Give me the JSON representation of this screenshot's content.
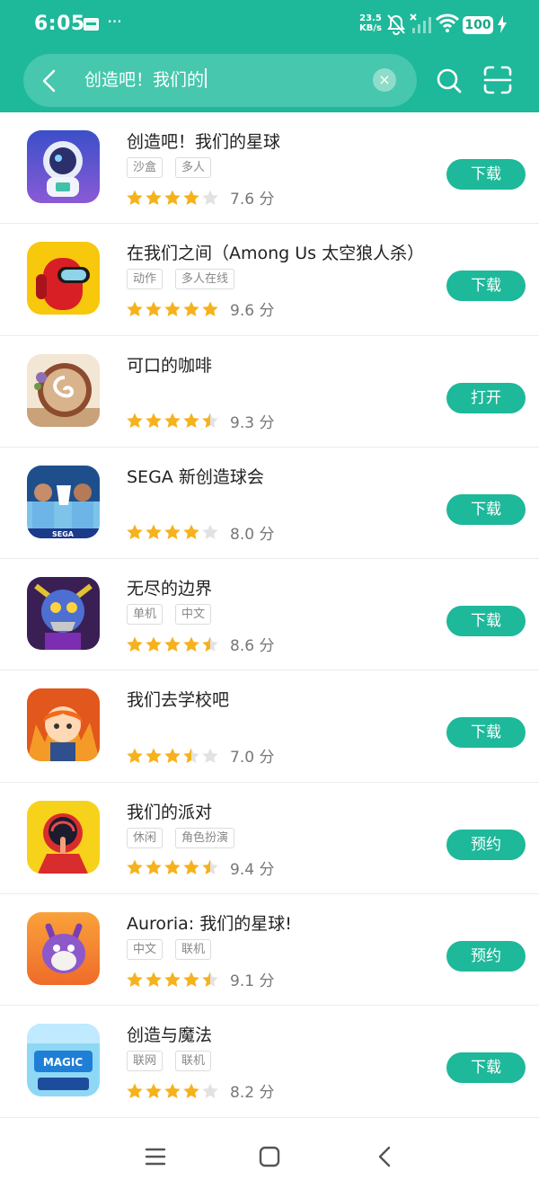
{
  "status": {
    "time": "6:05",
    "netspeed_value": "23.5",
    "netspeed_unit": "KB/s",
    "battery": "100",
    "dots": "···"
  },
  "search": {
    "query": "创造吧！我们的",
    "clear": "×"
  },
  "colors": {
    "accent": "#1eb89a",
    "star_on": "#f6b21c",
    "star_off": "#e2e2e2"
  },
  "apps": [
    {
      "name": "创造吧！我们的星球",
      "tags": [
        "沙盒",
        "多人"
      ],
      "rating": 4,
      "score": "7.6 分",
      "button": "下载"
    },
    {
      "name": "在我们之间（Among Us 太空狼人杀）",
      "tags": [
        "动作",
        "多人在线"
      ],
      "rating": 5,
      "score": "9.6 分",
      "button": "下载"
    },
    {
      "name": "可口的咖啡",
      "tags": [],
      "rating": 4.5,
      "score": "9.3 分",
      "button": "打开"
    },
    {
      "name": "SEGA 新创造球会",
      "tags": [],
      "rating": 4,
      "score": "8.0 分",
      "button": "下载"
    },
    {
      "name": "无尽的边界",
      "tags": [
        "单机",
        "中文"
      ],
      "rating": 4.5,
      "score": "8.6 分",
      "button": "下载"
    },
    {
      "name": "我们去学校吧",
      "tags": [],
      "rating": 3.5,
      "score": "7.0 分",
      "button": "下载"
    },
    {
      "name": "我们的派对",
      "tags": [
        "休闲",
        "角色扮演"
      ],
      "rating": 4.5,
      "score": "9.4 分",
      "button": "预约"
    },
    {
      "name": "Auroria: 我们的星球!",
      "tags": [
        "中文",
        "联机"
      ],
      "rating": 4.5,
      "score": "9.1 分",
      "button": "预约"
    },
    {
      "name": "创造与魔法",
      "tags": [
        "联网",
        "联机"
      ],
      "rating": 4,
      "score": "8.2 分",
      "button": "下载"
    }
  ]
}
